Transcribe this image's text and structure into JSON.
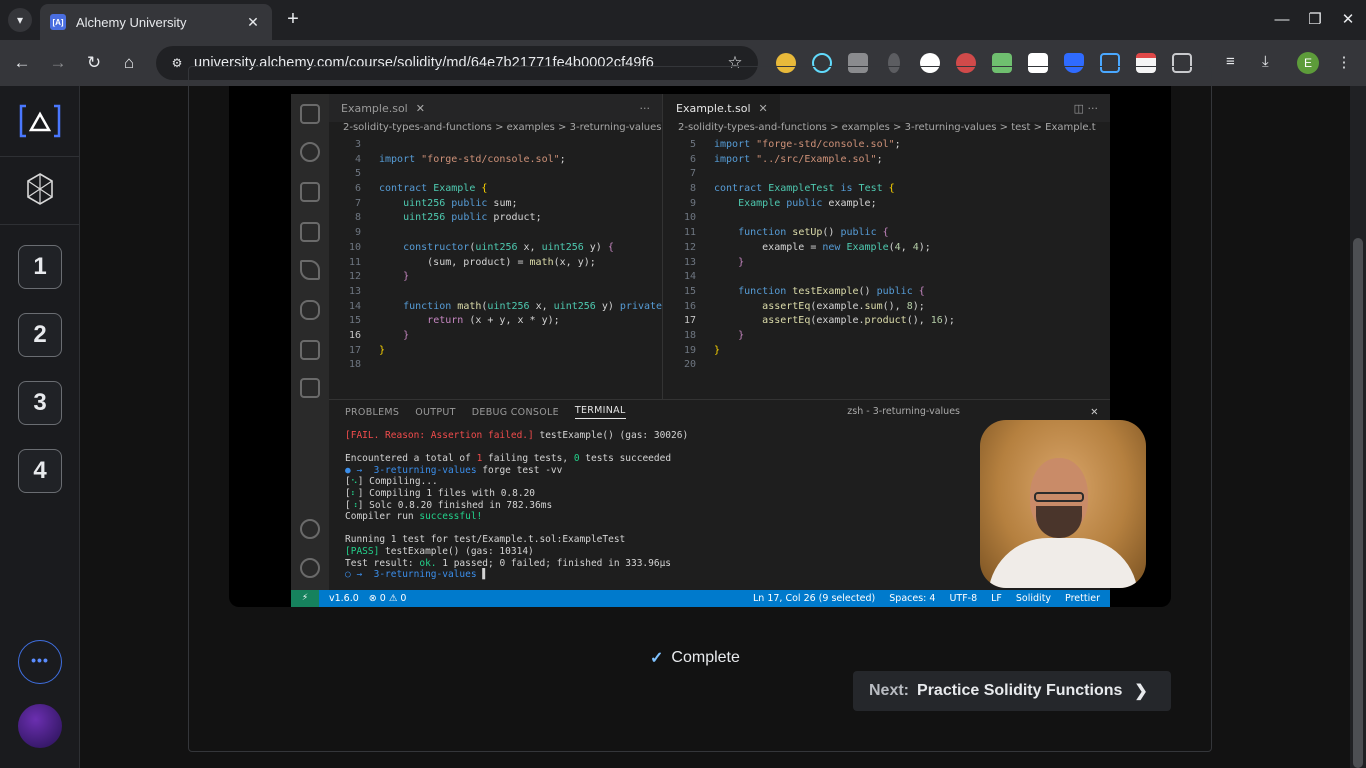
{
  "browser": {
    "tab_title": "Alchemy University",
    "tab_favicon": "[A]",
    "url": "university.alchemy.com/course/solidity/md/64e7b21771fe4b0002cf49f6",
    "profile_initial": "E"
  },
  "sidebar": {
    "steps": [
      "1",
      "2",
      "3",
      "4"
    ],
    "more_label": "•••"
  },
  "video": {
    "left_tab": "Example.sol",
    "right_tab": "Example.t.sol",
    "left_crumbs": "2-solidity-types-and-functions  >  examples  >  3-returning-values",
    "right_crumbs": "2-solidity-types-and-functions  >  examples  >  3-returning-values  >  test  >  Example.t",
    "panel_tabs": [
      "PROBLEMS",
      "OUTPUT",
      "DEBUG CONSOLE",
      "TERMINAL"
    ],
    "shell_label": "zsh - 3-returning-values",
    "status_left": [
      "v1.6.0",
      "⊗ 0 ⚠ 0"
    ],
    "status_right": [
      "Ln 17, Col 26 (9 selected)",
      "Spaces: 4",
      "UTF-8",
      "LF",
      "Solidity",
      "Prettier"
    ]
  },
  "actions": {
    "complete_label": "Complete",
    "next_prefix": "Next:",
    "next_title": "Practice Solidity Functions"
  }
}
